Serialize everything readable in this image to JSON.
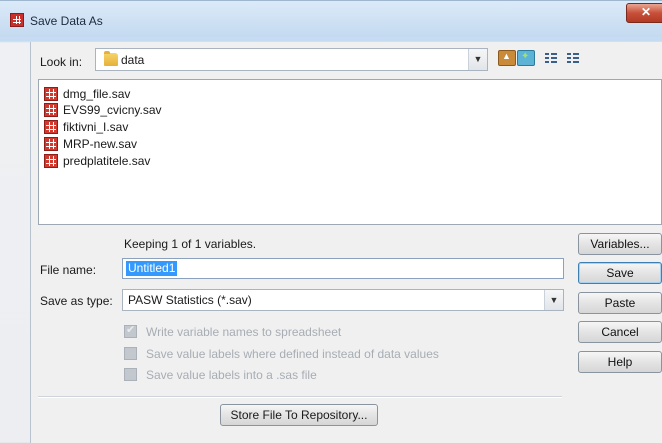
{
  "window": {
    "title": "Save Data As",
    "close_glyph": "✕"
  },
  "lookin": {
    "label": "Look in:",
    "value": "data",
    "icon": "folder-icon"
  },
  "toolbar": {
    "icons": [
      "up-folder-icon",
      "new-folder-icon",
      "list-view-icon",
      "details-view-icon"
    ]
  },
  "files": [
    {
      "name": "dmg_file.sav",
      "icon": "sav-file-icon"
    },
    {
      "name": "EVS99_cvicny.sav",
      "icon": "sav-file-icon"
    },
    {
      "name": "fiktivni_I.sav",
      "icon": "sav-file-icon"
    },
    {
      "name": "MRP-new.sav",
      "icon": "sav-file-icon"
    },
    {
      "name": "predplatitele.sav",
      "icon": "sav-file-icon"
    }
  ],
  "keeping_text": "Keeping 1 of 1 variables.",
  "filename": {
    "label": "File name:",
    "value": "Untitled1"
  },
  "savetype": {
    "label": "Save as type:",
    "value": "PASW Statistics (*.sav)"
  },
  "options": [
    {
      "label": "Write variable names to spreadsheet",
      "checked": true,
      "enabled": false
    },
    {
      "label": "Save value labels where defined instead of data values",
      "checked": false,
      "enabled": false
    },
    {
      "label": "Save value labels into a .sas file",
      "checked": false,
      "enabled": false
    }
  ],
  "buttons": {
    "variables": "Variables...",
    "save": "Save",
    "paste": "Paste",
    "cancel": "Cancel",
    "help": "Help",
    "store": "Store File To Repository..."
  }
}
